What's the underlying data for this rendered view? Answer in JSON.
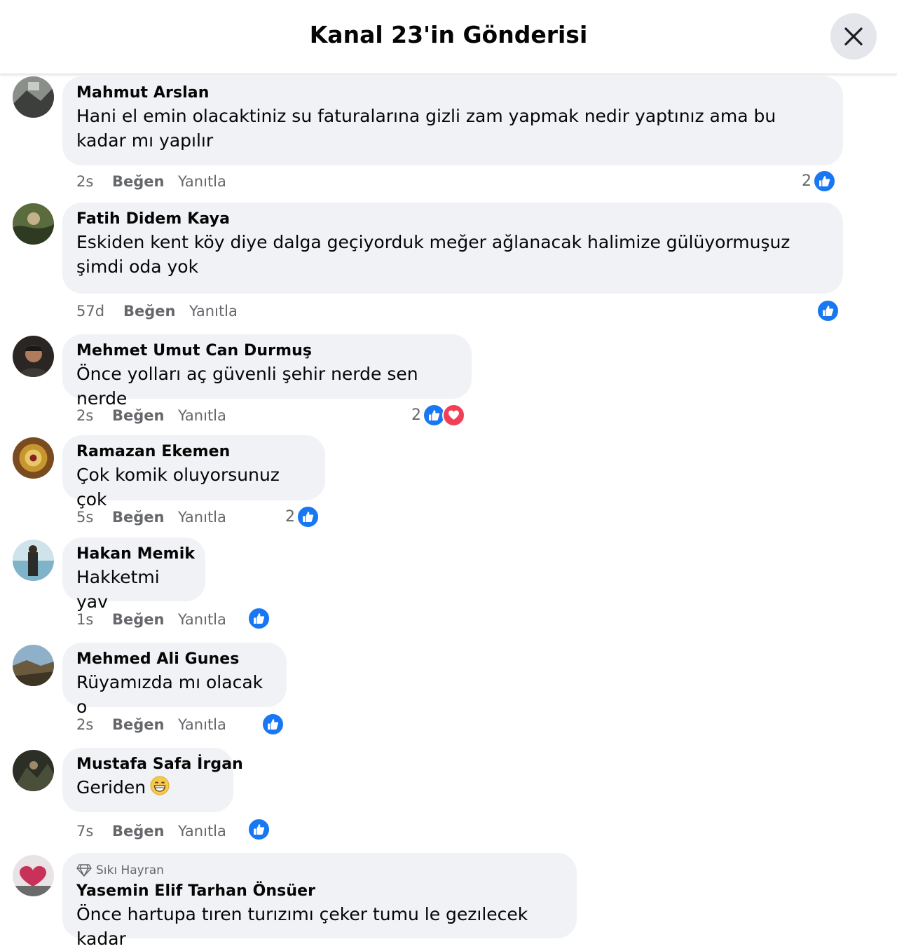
{
  "header": {
    "title": "Kanal 23'in Gönderisi"
  },
  "actions": {
    "like": "Beğen",
    "reply": "Yanıtla"
  },
  "comments": [
    {
      "name": "Mahmut Arslan",
      "text": "Hani el emin olacaktiniz su faturalarına gizli zam yapmak nedir yaptınız ama bu kadar mı yapılır",
      "time": "2s",
      "reactions": {
        "count": "2",
        "types": [
          "like"
        ]
      }
    },
    {
      "name": "Fatih Didem Kaya",
      "text": "Eskiden kent köy diye dalga geçiyorduk meğer ağlanacak halimize gülüyormuşuz şimdi oda yok",
      "time": "57d",
      "reactions": {
        "count": "",
        "types": [
          "like"
        ]
      }
    },
    {
      "name": "Mehmet Umut Can Durmuş",
      "text": "Önce yolları aç güvenli şehir nerde sen nerde",
      "time": "2s",
      "reactions": {
        "count": "2",
        "types": [
          "like",
          "love"
        ]
      }
    },
    {
      "name": "Ramazan Ekemen",
      "text": "Çok komik oluyorsunuz çok",
      "time": "5s",
      "reactions": {
        "count": "2",
        "types": [
          "like"
        ]
      }
    },
    {
      "name": "Hakan Memik",
      "text": "Hakketmi yav",
      "time": "1s",
      "reactions": {
        "count": "",
        "types": [
          "like"
        ]
      }
    },
    {
      "name": "Mehmed Ali Gunes",
      "text": "Rüyamızda mı olacak o",
      "time": "2s",
      "reactions": {
        "count": "",
        "types": [
          "like"
        ]
      }
    },
    {
      "name": "Mustafa Safa İrgan",
      "text": "Geriden",
      "emoji": "grinning-face-icon",
      "time": "7s",
      "reactions": {
        "count": "",
        "types": [
          "like"
        ]
      }
    },
    {
      "badge": "Sıkı Hayran",
      "name": "Yasemin Elif Tarhan Önsüer",
      "text": "Önce hartupa tıren turızımı çeker tumu le gezılecek kadar"
    }
  ],
  "colors": {
    "like": "#1877f2",
    "love": "#f33e58",
    "bubble": "#f0f2f5",
    "meta": "#65676b"
  }
}
